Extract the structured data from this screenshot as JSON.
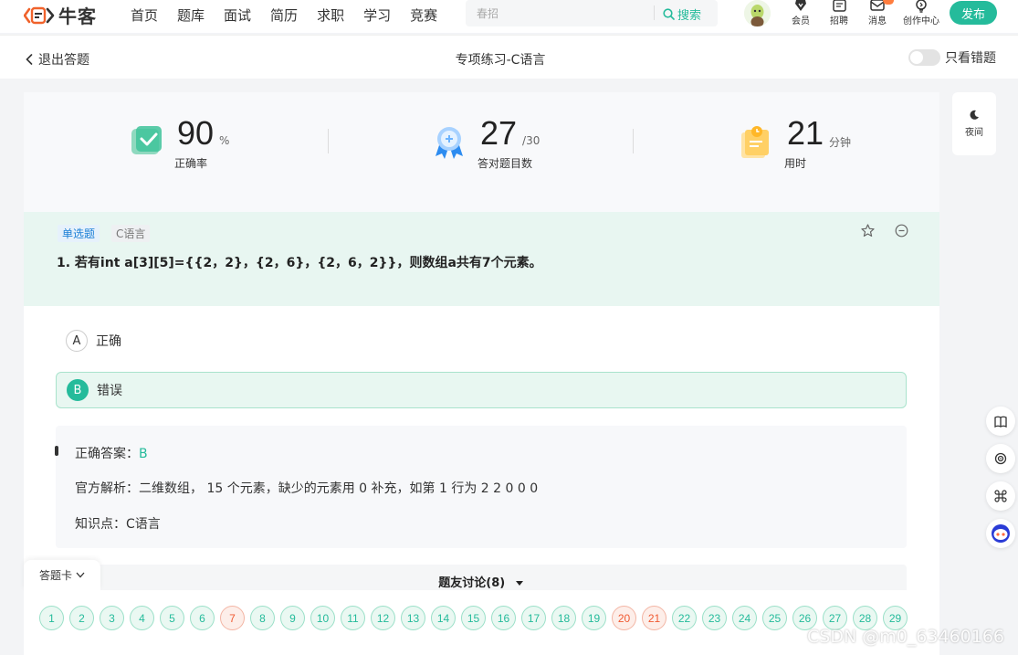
{
  "nav": {
    "logo_text": "牛客",
    "links": [
      "首页",
      "题库",
      "面试",
      "简历",
      "求职",
      "学习",
      "竞赛"
    ],
    "search_placeholder": "春招",
    "search_button": "搜索",
    "icons": [
      {
        "label": "会员",
        "icon": "vip-diamond-icon"
      },
      {
        "label": "招聘",
        "icon": "recruit-icon"
      },
      {
        "label": "消息",
        "icon": "message-icon"
      },
      {
        "label": "创作中心",
        "icon": "bulb-icon"
      }
    ],
    "publish": "发布"
  },
  "subheader": {
    "exit": "退出答题",
    "title": "专项练习-C语言",
    "toggle_label": "只看错题"
  },
  "stats": {
    "accuracy": {
      "value": "90",
      "unit": "%",
      "label": "正确率"
    },
    "correct": {
      "value": "27",
      "unit": "/30",
      "label": "答对题目数"
    },
    "time": {
      "value": "21",
      "unit": "分钟",
      "label": "用时"
    }
  },
  "question": {
    "type_tag": "单选题",
    "topic_tag": "C语言",
    "text": "1. 若有int a[3][5]={{2，2}，{2，6}，{2，6，2}}，则数组a共有7个元素。"
  },
  "options": [
    {
      "letter": "A",
      "text": "正确"
    },
    {
      "letter": "B",
      "text": "错误"
    }
  ],
  "analysis": {
    "answer_label": "正确答案：",
    "answer_value": "B",
    "explain": "官方解析：二维数组， 15 个元素，缺少的元素用 0 补充，如第 1 行为 2 2 0 0 0",
    "knowledge": "知识点：C语言"
  },
  "discussion": "题友讨论(8)",
  "answer_card": {
    "tab_label": "答题卡",
    "items": [
      {
        "n": "1",
        "status": "correct"
      },
      {
        "n": "2",
        "status": "correct"
      },
      {
        "n": "3",
        "status": "correct"
      },
      {
        "n": "4",
        "status": "correct"
      },
      {
        "n": "5",
        "status": "correct"
      },
      {
        "n": "6",
        "status": "correct"
      },
      {
        "n": "7",
        "status": "wrong"
      },
      {
        "n": "8",
        "status": "correct"
      },
      {
        "n": "9",
        "status": "correct"
      },
      {
        "n": "10",
        "status": "correct"
      },
      {
        "n": "11",
        "status": "correct"
      },
      {
        "n": "12",
        "status": "correct"
      },
      {
        "n": "13",
        "status": "correct"
      },
      {
        "n": "14",
        "status": "correct"
      },
      {
        "n": "15",
        "status": "correct"
      },
      {
        "n": "16",
        "status": "correct"
      },
      {
        "n": "17",
        "status": "correct"
      },
      {
        "n": "18",
        "status": "correct"
      },
      {
        "n": "19",
        "status": "correct"
      },
      {
        "n": "20",
        "status": "wrong"
      },
      {
        "n": "21",
        "status": "wrong"
      },
      {
        "n": "22",
        "status": "correct"
      },
      {
        "n": "23",
        "status": "correct"
      },
      {
        "n": "24",
        "status": "correct"
      },
      {
        "n": "25",
        "status": "correct"
      },
      {
        "n": "26",
        "status": "correct"
      },
      {
        "n": "27",
        "status": "correct"
      },
      {
        "n": "28",
        "status": "correct"
      },
      {
        "n": "29",
        "status": "correct"
      }
    ]
  },
  "night_mode": "夜间",
  "watermark": "CSDN @m0_63460166",
  "colors": {
    "accent": "#25bb9b",
    "wrong": "#f05a32",
    "question_bg": "#e8f6f1"
  }
}
